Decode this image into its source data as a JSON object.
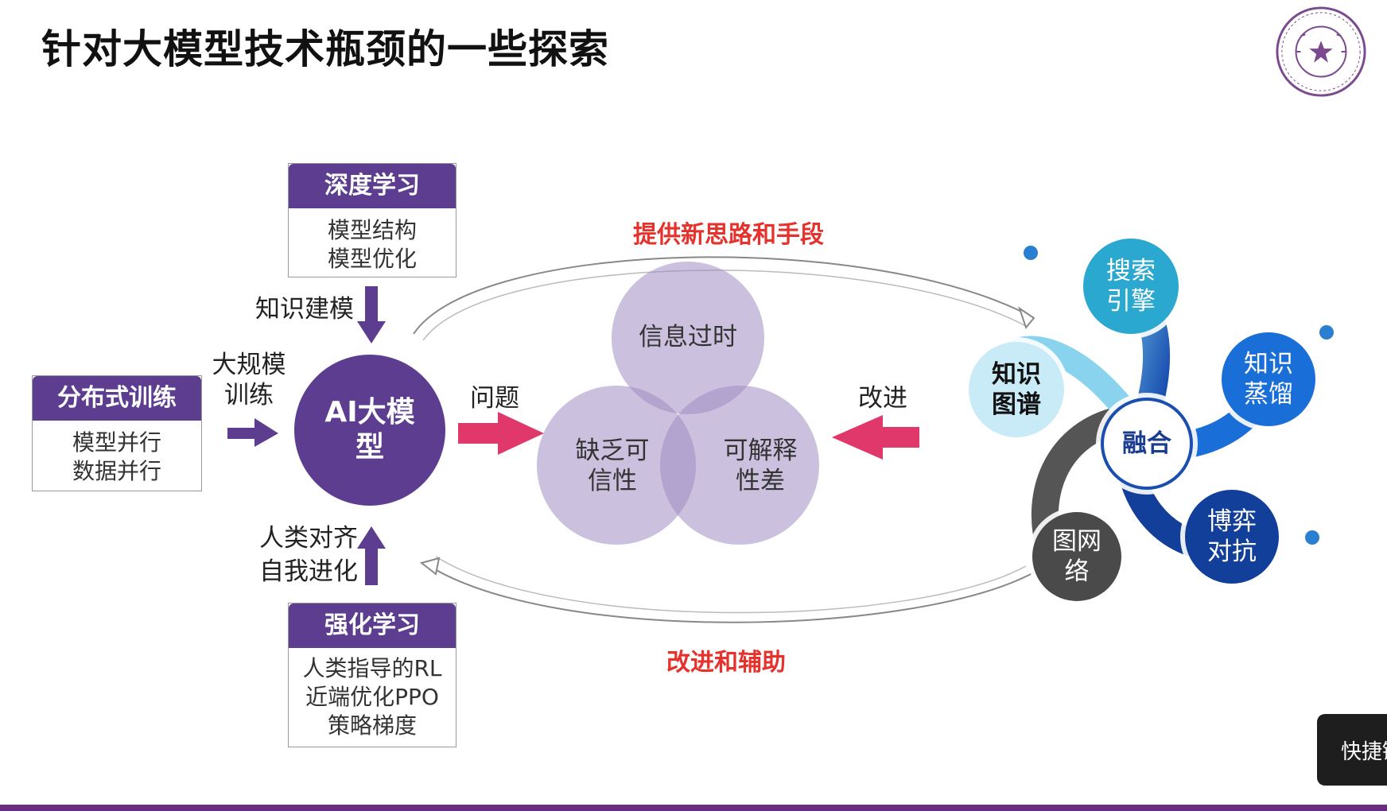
{
  "slide": {
    "title": "针对大模型技术瓶颈的一些探索"
  },
  "boxes": {
    "deep_learning": {
      "title": "深度学习",
      "lines": [
        "模型结构",
        "模型优化"
      ]
    },
    "distributed": {
      "title": "分布式训练",
      "lines": [
        "模型并行",
        "数据并行"
      ]
    },
    "reinforcement": {
      "title": "强化学习",
      "lines": [
        "人类指导的RL",
        "近端优化PPO",
        "策略梯度"
      ]
    }
  },
  "labels": {
    "knowledge_modeling": "知识建模",
    "large_scale_1": "大规模",
    "large_scale_2": "训练",
    "human_align": "人类对齐",
    "self_evolve": "自我进化",
    "problem": "问题",
    "improve": "改进",
    "top_arc": "提供新思路和手段",
    "bottom_arc": "改进和辅助"
  },
  "center": {
    "ai_line1": "AI大模",
    "ai_line2": "型"
  },
  "venn": {
    "top": "信息过时",
    "left_1": "缺乏可",
    "left_2": "信性",
    "right_1": "可解释",
    "right_2": "性差"
  },
  "fusion": {
    "center": "融合",
    "search_1": "搜索",
    "search_2": "引擎",
    "distill_1": "知识",
    "distill_2": "蒸馏",
    "kg_1": "知识",
    "kg_2": "图谱",
    "game_1": "博弈",
    "game_2": "对抗",
    "gnn_1": "图网",
    "gnn_2": "络"
  },
  "toast": {
    "text": "快捷键"
  },
  "colors": {
    "purple": "#5c3d8f",
    "pink_arrow": "#e0386a",
    "red_text": "#e5322d",
    "venn_fill": "#a18cc2"
  }
}
